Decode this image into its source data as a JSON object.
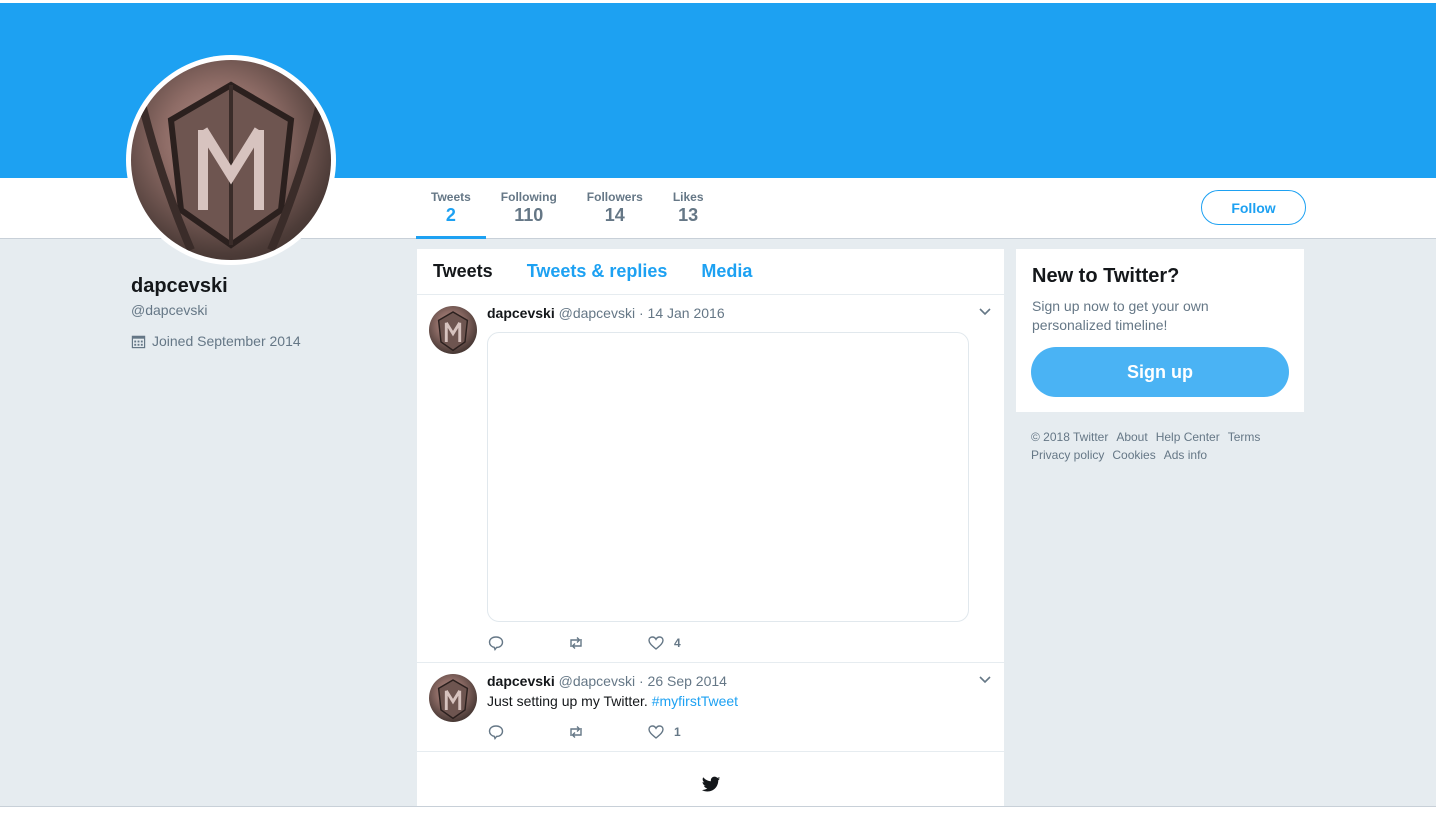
{
  "colors": {
    "brand": "#1da1f2",
    "banner": "#1da1f2",
    "page_bg": "#e6ecf0",
    "signup_button": "#4ab3f4"
  },
  "profile": {
    "name": "dapcevski",
    "handle": "@dapcevski",
    "joined": "Joined September 2014"
  },
  "stats": [
    {
      "label": "Tweets",
      "value": "2"
    },
    {
      "label": "Following",
      "value": "110"
    },
    {
      "label": "Followers",
      "value": "14"
    },
    {
      "label": "Likes",
      "value": "13"
    }
  ],
  "follow_label": "Follow",
  "tabs": [
    "Tweets",
    "Tweets & replies",
    "Media"
  ],
  "tweets": [
    {
      "name": "dapcevski",
      "handle": "@dapcevski",
      "dot": "·",
      "date": "14 Jan 2016",
      "likes": "4"
    },
    {
      "name": "dapcevski",
      "handle": "@dapcevski",
      "dot": "·",
      "date": "26 Sep 2014",
      "text": "Just setting up my Twitter. ",
      "hashtag": "#myfirstTweet",
      "likes": "1"
    }
  ],
  "signup": {
    "title": "New to Twitter?",
    "text": "Sign up now to get your own personalized timeline!",
    "button": "Sign up"
  },
  "footer": {
    "copyright": "© 2018 Twitter",
    "links": [
      "About",
      "Help Center",
      "Terms",
      "Privacy policy",
      "Cookies",
      "Ads info"
    ]
  },
  "icons": {
    "reply": "reply-icon",
    "retweet": "retweet-icon",
    "like": "heart-icon",
    "caret": "chevron-down-icon",
    "calendar": "calendar-icon",
    "logo": "twitter-bird-icon"
  }
}
